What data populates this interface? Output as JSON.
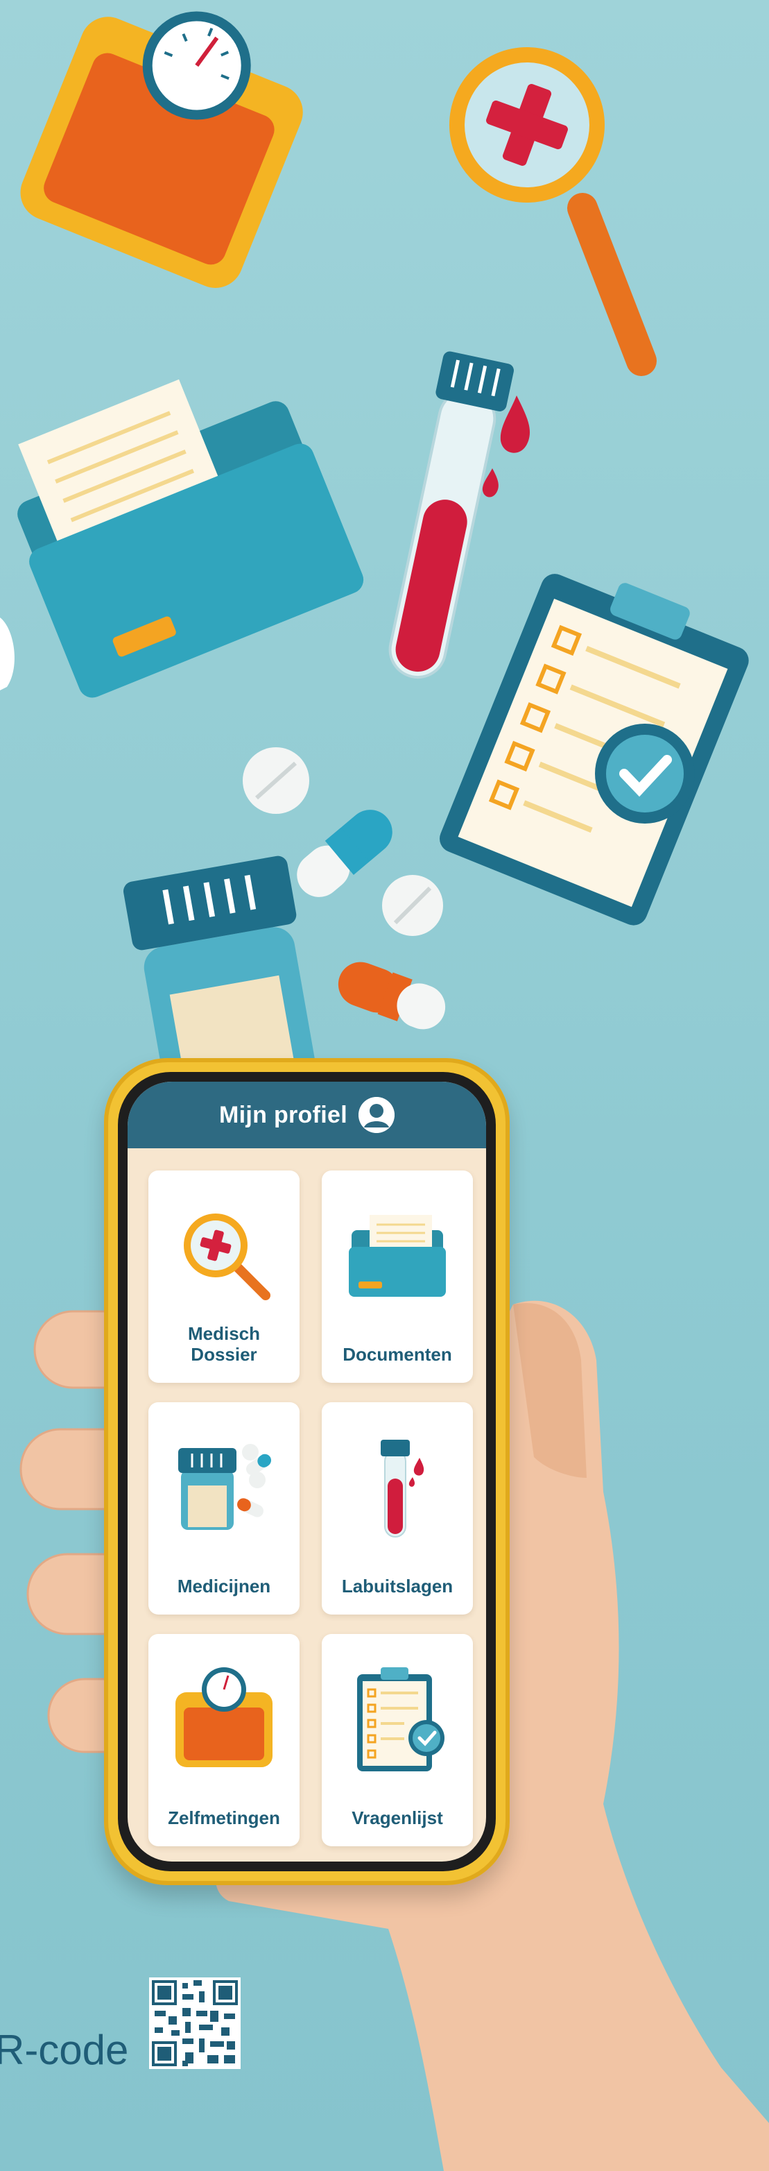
{
  "header": {
    "title": "Mijn profiel",
    "avatar_icon": "user-avatar-icon"
  },
  "tiles": [
    {
      "label": "Medisch\nDossier",
      "icon": "magnifier-cross-icon"
    },
    {
      "label": "Documenten",
      "icon": "folder-icon"
    },
    {
      "label": "Medicijnen",
      "icon": "medicine-bottle-icon"
    },
    {
      "label": "Labuitslagen",
      "icon": "test-tube-icon"
    },
    {
      "label": "Zelfmetingen",
      "icon": "weighing-scale-icon"
    },
    {
      "label": "Vragenlijst",
      "icon": "clipboard-checklist-icon"
    }
  ],
  "footer": {
    "qr_text": "R-code"
  },
  "colors": {
    "background": "#8fcad2",
    "header": "#2e6a82",
    "label": "#1f5d77",
    "phone_case": "#f2c233",
    "screen_bg": "#f7e6cf"
  }
}
